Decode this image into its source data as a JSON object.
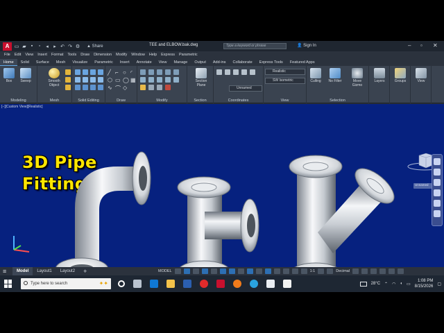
{
  "window": {
    "title": "TEE and ELBOW.bak.dwg",
    "search_placeholder": "Type a keyword or phrase",
    "share_label": "Share",
    "signin_label": "Sign In"
  },
  "menu": [
    "File",
    "Edit",
    "View",
    "Insert",
    "Format",
    "Tools",
    "Draw",
    "Dimension",
    "Modify",
    "Window",
    "Help",
    "Express",
    "Parametric"
  ],
  "ribbon_tabs": [
    "Home",
    "Solid",
    "Surface",
    "Mesh",
    "Visualize",
    "Parametric",
    "Insert",
    "Annotate",
    "View",
    "Manage",
    "Output",
    "Add-ins",
    "Collaborate",
    "Express Tools",
    "Featured Apps"
  ],
  "ribbon": {
    "modeling": {
      "label": "Modeling",
      "box": "Box",
      "sweep": "Sweep"
    },
    "mesh": {
      "label": "Mesh",
      "smooth": "Smooth Object"
    },
    "solid_editing": {
      "label": "Solid Editing"
    },
    "draw": {
      "label": "Draw"
    },
    "modify": {
      "label": "Modify"
    },
    "section": {
      "label": "Section",
      "plane": "Section Plane"
    },
    "coordinates": {
      "label": "Coordinates",
      "ucs": "Unnamed"
    },
    "view": {
      "label": "View",
      "visual_style": "Realistic",
      "view_dir": "SW Isometric"
    },
    "selection": {
      "label": "Selection",
      "culling": "Culling",
      "filter": "No Filter",
      "gizmo": "Move Gizmo"
    },
    "layers": "Layers",
    "groups": "Groups",
    "view_btn": "View"
  },
  "viewport": {
    "label": "[−][Custom View][Realistic]",
    "headline_line1": "3D Pipe",
    "headline_line2": "Fittings",
    "viewcube_label": "Unnamed"
  },
  "layouts": [
    "Model",
    "Layout1",
    "Layout2"
  ],
  "status": {
    "model": "MODEL",
    "scale": "1:1",
    "units": "Decimal"
  },
  "taskbar": {
    "search_placeholder": "Type here to search",
    "temperature": "28°C",
    "time": "1:08 PM",
    "date": "8/15/2026"
  }
}
